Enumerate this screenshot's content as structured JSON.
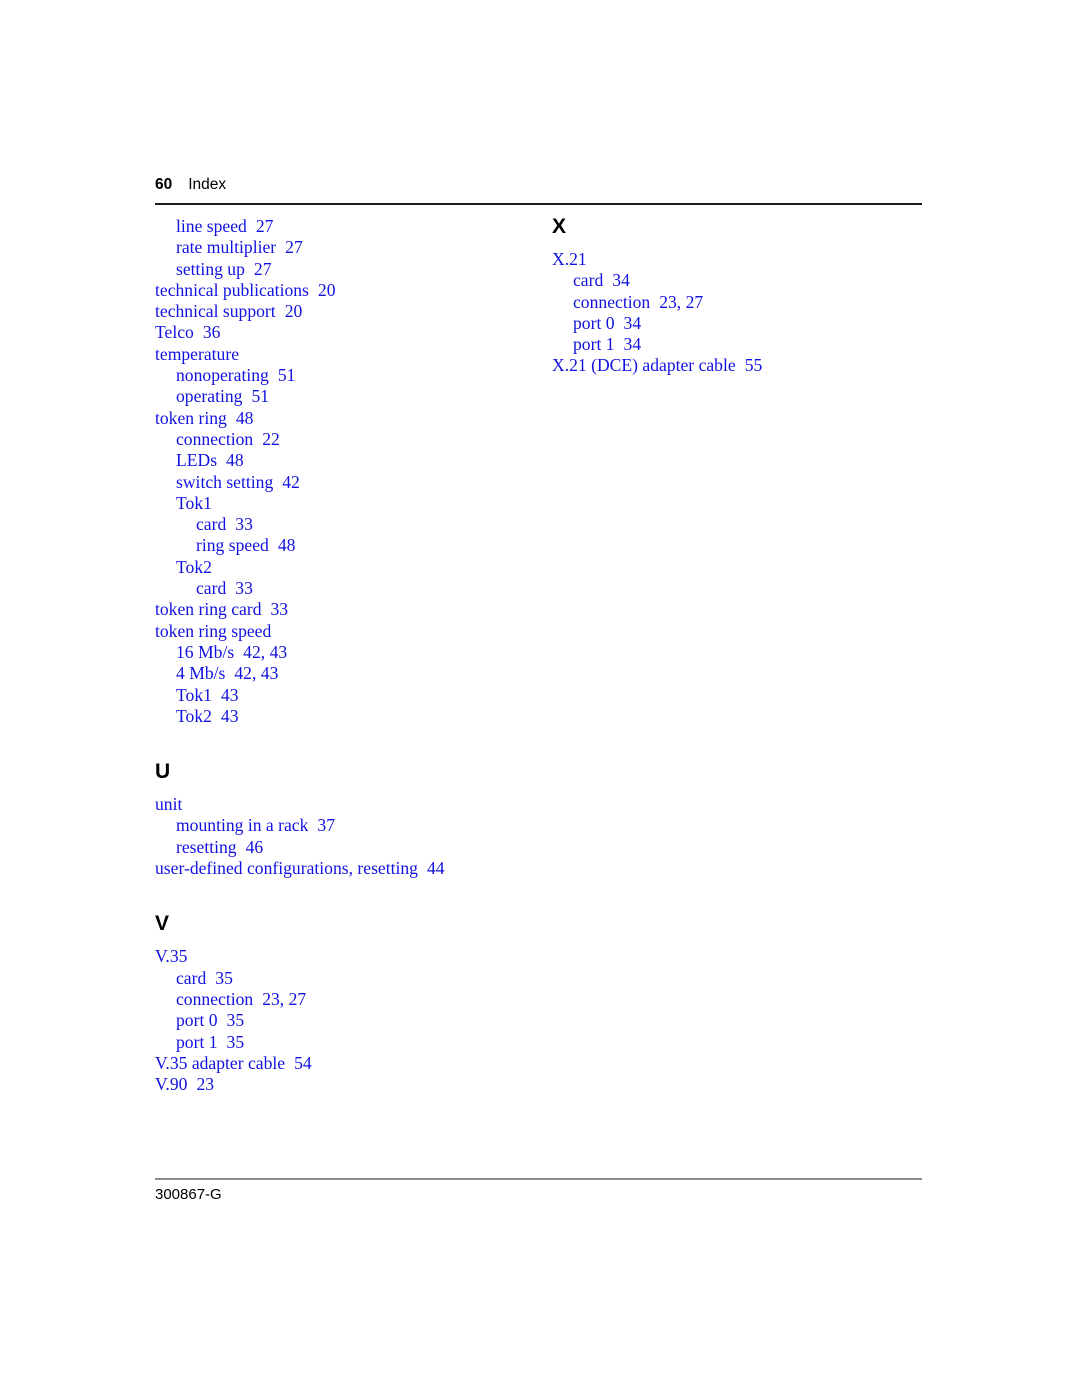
{
  "header": {
    "page_number": "60",
    "title": "Index"
  },
  "footer": {
    "doc_number": "300867-G"
  },
  "colors": {
    "entry_blue": "#1212e0",
    "rule_dark": "#1a1a1a",
    "rule_gray": "#8c8c8c",
    "heading_black": "#000000"
  },
  "left_column": {
    "continued_entries": [
      {
        "level": 1,
        "text": "line speed",
        "pages": "27"
      },
      {
        "level": 1,
        "text": "rate multiplier",
        "pages": "27"
      },
      {
        "level": 1,
        "text": "setting up",
        "pages": "27"
      },
      {
        "level": 0,
        "text": "technical publications",
        "pages": "20"
      },
      {
        "level": 0,
        "text": "technical support",
        "pages": "20"
      },
      {
        "level": 0,
        "text": "Telco",
        "pages": "36"
      },
      {
        "level": 0,
        "text": "temperature",
        "pages": ""
      },
      {
        "level": 1,
        "text": "nonoperating",
        "pages": "51"
      },
      {
        "level": 1,
        "text": "operating",
        "pages": "51"
      },
      {
        "level": 0,
        "text": "token ring",
        "pages": "48"
      },
      {
        "level": 1,
        "text": "connection",
        "pages": "22"
      },
      {
        "level": 1,
        "text": "LEDs",
        "pages": "48"
      },
      {
        "level": 1,
        "text": "switch setting",
        "pages": "42"
      },
      {
        "level": 1,
        "text": "Tok1",
        "pages": ""
      },
      {
        "level": 2,
        "text": "card",
        "pages": "33"
      },
      {
        "level": 2,
        "text": "ring speed",
        "pages": "48"
      },
      {
        "level": 1,
        "text": "Tok2",
        "pages": ""
      },
      {
        "level": 2,
        "text": "card",
        "pages": "33"
      },
      {
        "level": 0,
        "text": "token ring card",
        "pages": "33"
      },
      {
        "level": 0,
        "text": "token ring speed",
        "pages": ""
      },
      {
        "level": 1,
        "text": "16 Mb/s",
        "pages": "42, 43"
      },
      {
        "level": 1,
        "text": "4 Mb/s",
        "pages": "42, 43"
      },
      {
        "level": 1,
        "text": "Tok1",
        "pages": "43"
      },
      {
        "level": 1,
        "text": "Tok2",
        "pages": "43"
      }
    ],
    "sections": [
      {
        "letter": "U",
        "entries": [
          {
            "level": 0,
            "text": "unit",
            "pages": ""
          },
          {
            "level": 1,
            "text": "mounting in a rack",
            "pages": "37"
          },
          {
            "level": 1,
            "text": "resetting",
            "pages": "46"
          },
          {
            "level": 0,
            "text": "user-defined configurations, resetting",
            "pages": "44"
          }
        ]
      },
      {
        "letter": "V",
        "entries": [
          {
            "level": 0,
            "text": "V.35",
            "pages": ""
          },
          {
            "level": 1,
            "text": "card",
            "pages": "35"
          },
          {
            "level": 1,
            "text": "connection",
            "pages": "23, 27"
          },
          {
            "level": 1,
            "text": "port 0",
            "pages": "35"
          },
          {
            "level": 1,
            "text": "port 1",
            "pages": "35"
          },
          {
            "level": 0,
            "text": "V.35 adapter cable",
            "pages": "54"
          },
          {
            "level": 0,
            "text": "V.90",
            "pages": "23"
          }
        ]
      }
    ]
  },
  "right_column": {
    "sections": [
      {
        "letter": "X",
        "entries": [
          {
            "level": 0,
            "text": "X.21",
            "pages": ""
          },
          {
            "level": 1,
            "text": "card",
            "pages": "34"
          },
          {
            "level": 1,
            "text": "connection",
            "pages": "23, 27"
          },
          {
            "level": 1,
            "text": "port 0",
            "pages": "34"
          },
          {
            "level": 1,
            "text": "port 1",
            "pages": "34"
          },
          {
            "level": 0,
            "text": "X.21 (DCE) adapter cable",
            "pages": "55"
          }
        ]
      }
    ]
  }
}
